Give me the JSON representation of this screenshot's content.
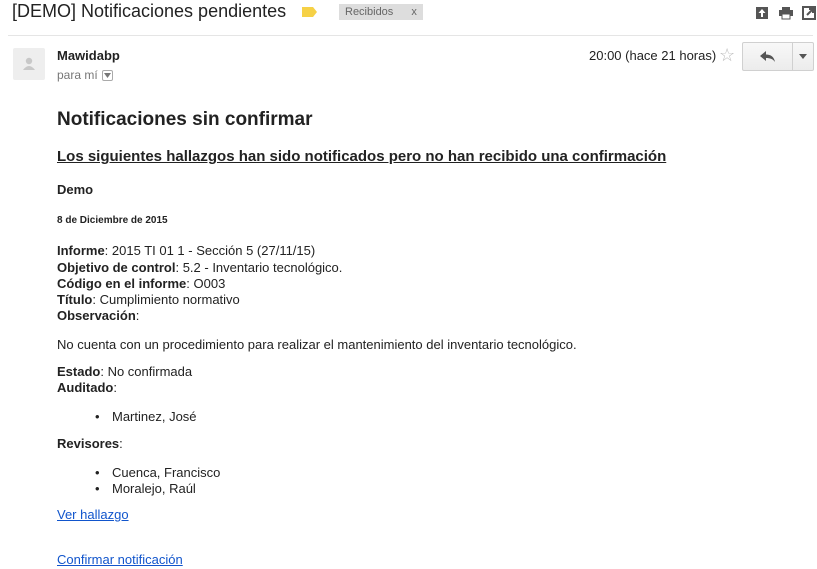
{
  "header": {
    "subject": "[DEMO] Notificaciones pendientes",
    "label": "Recibidos",
    "label_remove": "x"
  },
  "message": {
    "sender": "Mawidabp",
    "recipient": "para mí",
    "time": "20:00 (hace 21 horas)"
  },
  "content": {
    "title": "Notificaciones sin confirmar",
    "subtitle": "Los siguientes hallazgos han sido notificados pero no han recibido una confirmación",
    "organization": "Demo",
    "date": "8 de Diciembre de 2015",
    "fields": {
      "informe_label": "Informe",
      "informe_value": ": 2015 TI 01 1 - Sección 5 (27/11/15)",
      "objetivo_label": "Objetivo de control",
      "objetivo_value": ": 5.2 - Inventario tecnológico.",
      "codigo_label": "Código en el informe",
      "codigo_value": ": O003",
      "titulo_label": "Título",
      "titulo_value": ": Cumplimiento normativo",
      "observacion_label": "Observación",
      "observacion_value": ":"
    },
    "observation_text": "No cuenta con un procedimiento para realizar el mantenimiento del inventario tecnológico.",
    "estado_label": "Estado",
    "estado_value": ": No confirmada",
    "auditado_label": "Auditado",
    "auditado_value": ":",
    "auditados": [
      "Martinez, José"
    ],
    "revisores_label": "Revisores",
    "revisores_value": ":",
    "revisores": [
      "Cuenca, Francisco",
      "Moralejo, Raúl"
    ],
    "link_ver": "Ver hallazgo",
    "link_confirmar": "Confirmar notificación"
  },
  "colors": {
    "link": "#1155cc",
    "label_tag": "#f6d146",
    "chip_bg": "#dddddd"
  }
}
